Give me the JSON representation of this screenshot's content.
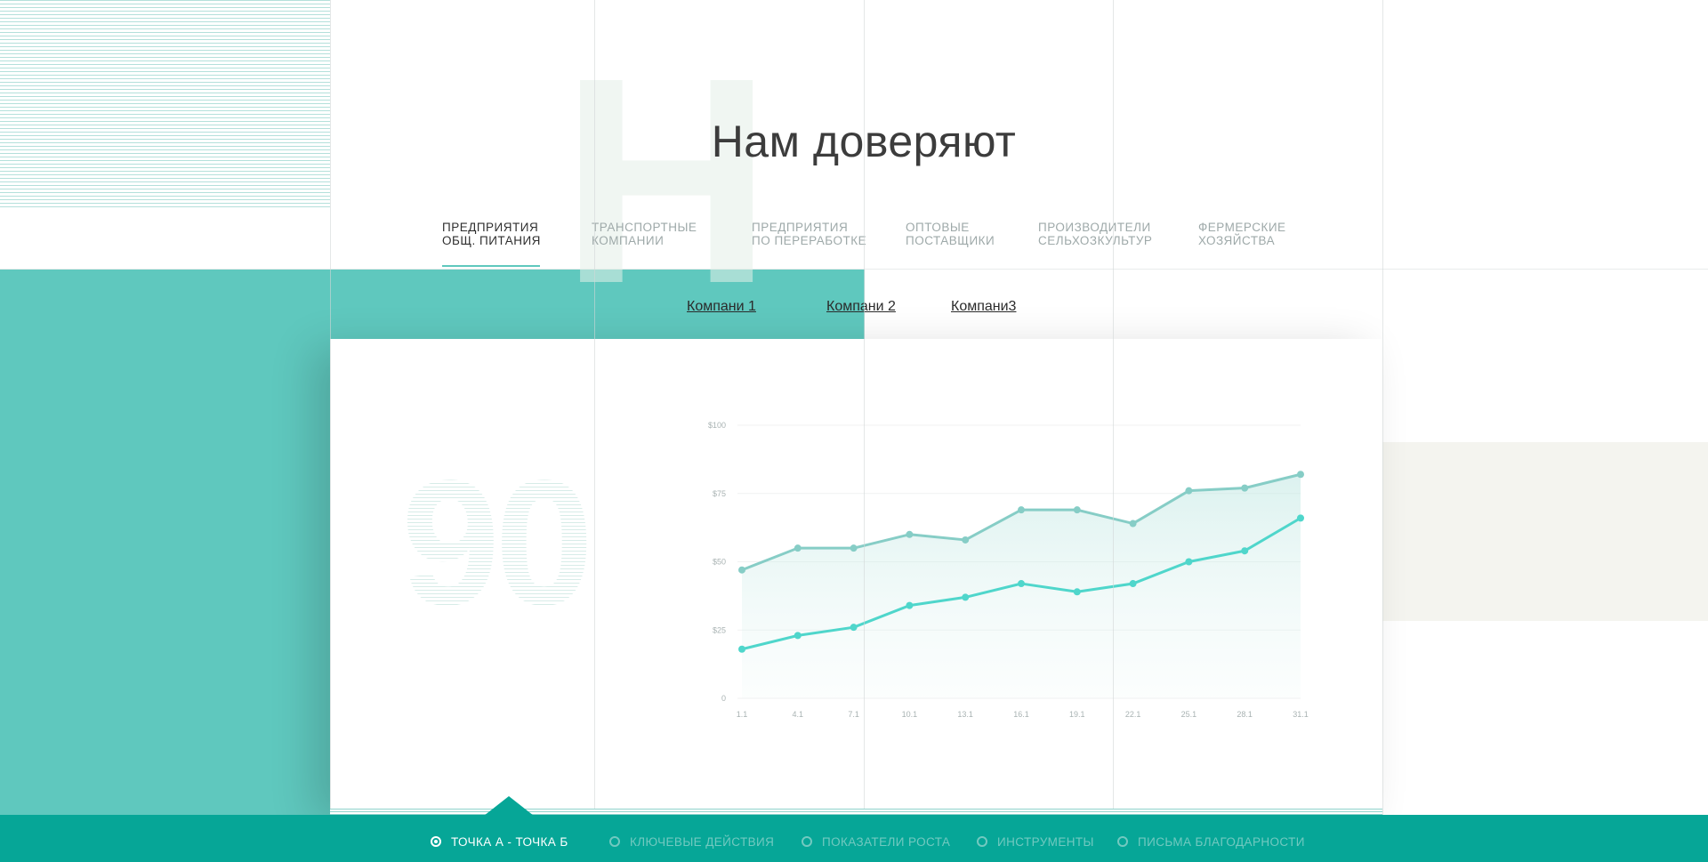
{
  "title": "Нам доверяют",
  "background_letter": "Н",
  "categories": [
    {
      "label": "ПРЕДПРИЯТИЯ\nОБЩ. ПИТАНИЯ",
      "active": true
    },
    {
      "label": "ТРАНСПОРТНЫЕ\nКОМПАНИИ",
      "active": false
    },
    {
      "label": "ПРЕДПРИЯТИЯ\nПО ПЕРЕРАБОТКЕ",
      "active": false
    },
    {
      "label": "ОПТОВЫЕ\nПОСТАВЩИКИ",
      "active": false
    },
    {
      "label": "ПРОИЗВОДИТЕЛИ\nСЕЛЬХОЗКУЛЬТУР",
      "active": false
    },
    {
      "label": "ФЕРМЕРСКИЕ\nХОЗЯЙСТВА",
      "active": false
    }
  ],
  "companies": [
    "Компани 1",
    "Компани 2",
    "Компани3"
  ],
  "big_number": "90",
  "chart_data": {
    "type": "line",
    "x": [
      "1.1",
      "4.1",
      "7.1",
      "10.1",
      "13.1",
      "16.1",
      "19.1",
      "22.1",
      "25.1",
      "28.1",
      "31.1"
    ],
    "ylim": [
      0,
      100
    ],
    "yticks": [
      "0",
      "$25",
      "$50",
      "$75",
      "$100"
    ],
    "series": [
      {
        "values": [
          47,
          55,
          55,
          60,
          58,
          69,
          69,
          64,
          76,
          77,
          82
        ],
        "color": "#86cdc6"
      },
      {
        "values": [
          18,
          23,
          26,
          34,
          37,
          42,
          39,
          42,
          50,
          54,
          66
        ],
        "color": "#4fd6cb"
      }
    ]
  },
  "bottom_nav": [
    {
      "label": "ТОЧКА А - ТОЧКА Б",
      "active": true
    },
    {
      "label": "КЛЮЧЕВЫЕ ДЕЙСТВИЯ",
      "active": false
    },
    {
      "label": "ПОКАЗАТЕЛИ РОСТА",
      "active": false
    },
    {
      "label": "ИНСТРУМЕНТЫ",
      "active": false
    },
    {
      "label": "ПИСЬМА БЛАГОДАРНОСТИ",
      "active": false
    }
  ],
  "colors": {
    "teal": "#5fc8be",
    "teal_dark": "#06a697",
    "beige": "#f4f4ef"
  }
}
